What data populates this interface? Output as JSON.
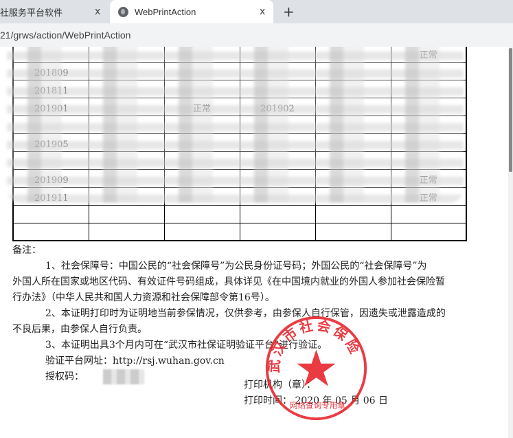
{
  "browser": {
    "tabs": [
      {
        "label": "社服务平台软件",
        "close": "x"
      },
      {
        "label": "WebPrintAction",
        "close": "x",
        "icon": "globe-icon"
      }
    ],
    "new_tab": "+",
    "url": "21/grws/action/WebPrintAction"
  },
  "table": {
    "rows": [
      [
        "",
        "",
        "",
        "",
        "",
        "正常"
      ],
      [
        "201809",
        "",
        "",
        "",
        "",
        ""
      ],
      [
        "201811",
        "",
        "",
        "",
        "",
        ""
      ],
      [
        "201901",
        "",
        "正常",
        "201902",
        "",
        ""
      ],
      [
        "",
        "",
        "",
        "",
        "",
        ""
      ],
      [
        "201905",
        "",
        "",
        "",
        "",
        ""
      ],
      [
        "",
        "",
        "",
        "",
        "",
        ""
      ],
      [
        "201909",
        "",
        "",
        "",
        "",
        "正常"
      ],
      [
        "201911",
        "",
        "",
        "",
        "",
        "正常"
      ],
      [
        "",
        "",
        "",
        "",
        "",
        ""
      ],
      [
        "",
        "",
        "",
        "",
        "",
        ""
      ]
    ]
  },
  "notes": {
    "title": "备注：",
    "n1a": "1、社会保障号：中国公民的“社会保障号”为公民身份证号码；外国公民的“社会保障号”为",
    "n1b": "外国人所在国家或地区代码、有效证件号码组成，具体详见《在中国境内就业的外国人参加社会保险暂",
    "n1c": "行办法》（中华人民共和国人力资源和社会保障部令第16号）。",
    "n2a": "2、本证明打印时为证明地当前参保情况，仅供参考，由参保人自行保管，因遗失或泄露造成的",
    "n2b": "不良后果，由参保人自行负责。",
    "n3": "3、本证明出具3个月内可在“武汉市社保证明验证平台”进行验证。",
    "url_label": "验证平台网址：http://rsj.wuhan.gov.cn",
    "auth_label": "授权码："
  },
  "signature": {
    "org": "打印机构（章）：",
    "time": "打印时间： 2020 年 05 月 06 日"
  },
  "stamp": {
    "top_text": "武汉市社会保险",
    "bottom_text": "网络查询专用章",
    "color": "#e8202a"
  }
}
